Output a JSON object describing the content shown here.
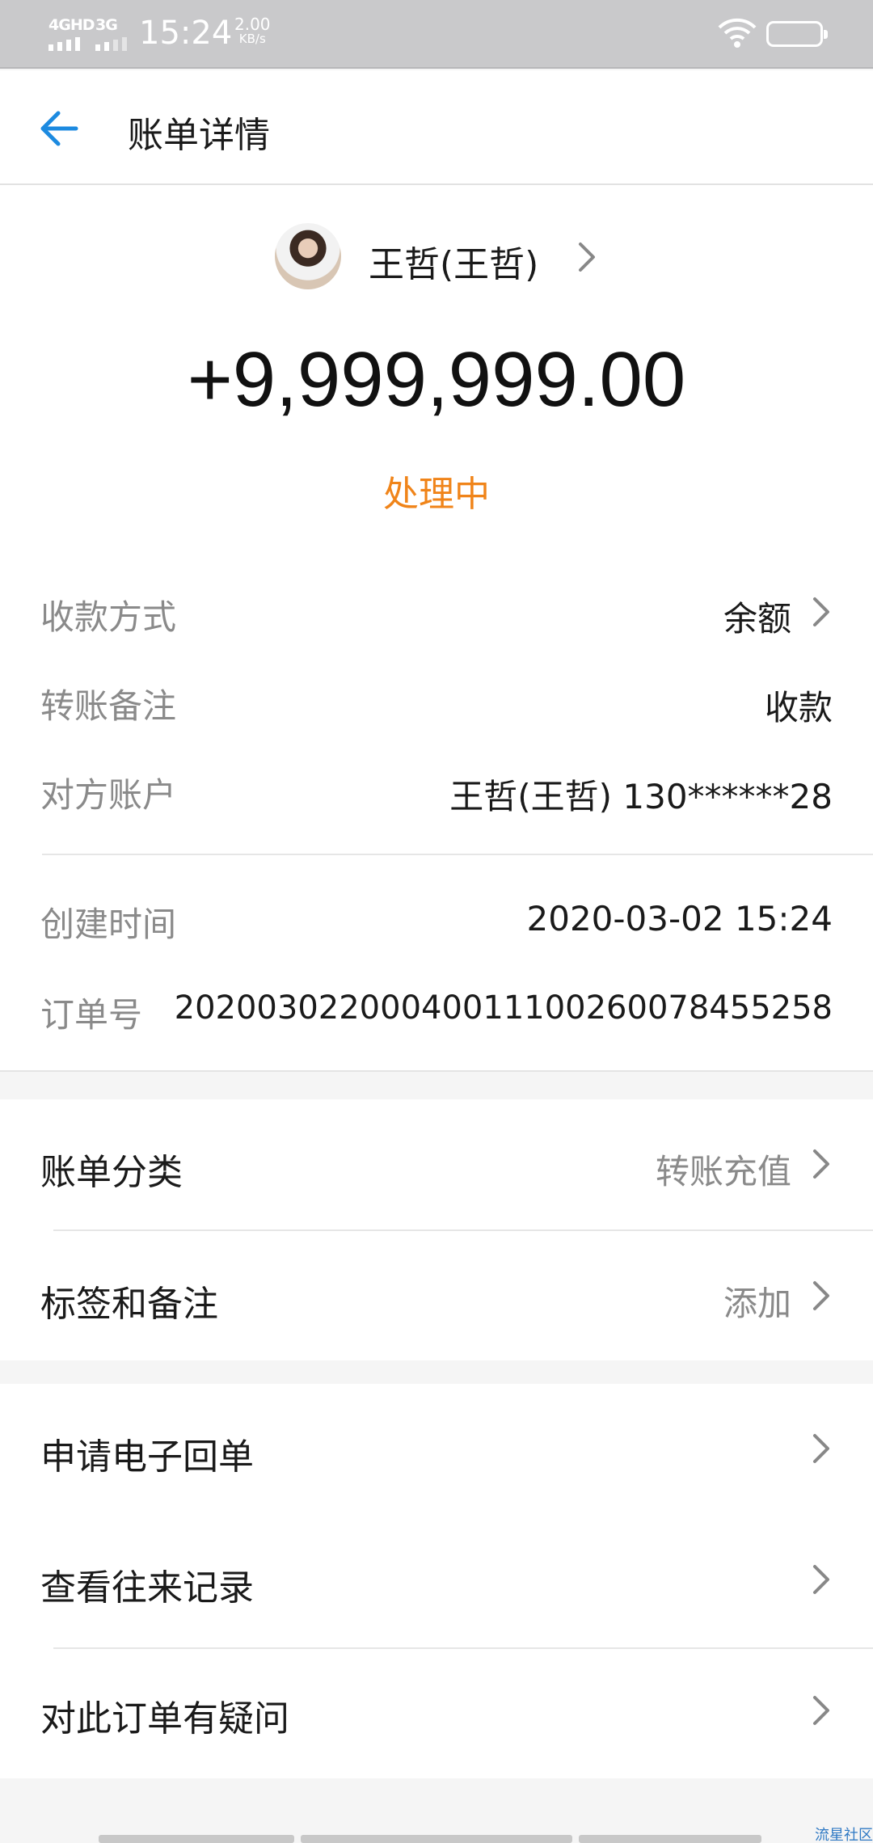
{
  "status_bar": {
    "network1": "4GHD",
    "network2": "3G",
    "time": "15:24",
    "speed_value": "2.00",
    "speed_unit": "KB/s"
  },
  "header": {
    "back_icon": "back-arrow-icon",
    "title": "账单详情"
  },
  "transaction": {
    "payee_name": "王哲(王哲)",
    "amount": "+9,999,999.00",
    "status": "处理中",
    "status_color": "#f08419"
  },
  "details": [
    {
      "label": "收款方式",
      "value": "余额"
    },
    {
      "label": "转账备注",
      "value": "收款"
    },
    {
      "label": "对方账户",
      "value": "王哲(王哲) 130******28"
    },
    {
      "label": "创建时间",
      "value": "2020-03-02 15:24"
    },
    {
      "label": "订单号",
      "value": "20200302200040011100260078455258"
    }
  ],
  "category_section": [
    {
      "label": "账单分类",
      "value": "转账充值"
    },
    {
      "label": "标签和备注",
      "value": "添加"
    }
  ],
  "actions": [
    {
      "label": "申请电子回单"
    },
    {
      "label": "查看往来记录"
    },
    {
      "label": "对此订单有疑问"
    }
  ],
  "watermark": "流星社区",
  "accent_color": "#1c8ae0"
}
